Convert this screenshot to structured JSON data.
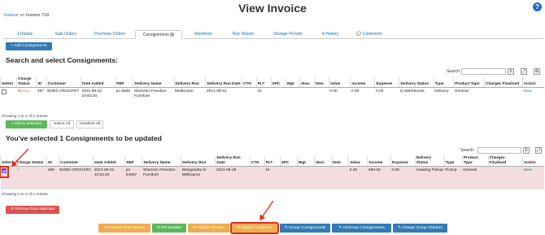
{
  "header": {
    "breadcrumb_link": "Invoice",
    "breadcrumb_rest": " >> Invoice 718",
    "title": "View Invoice",
    "help_glyph": "?"
  },
  "tabs": [
    {
      "label": "Details",
      "icon": "info-icon",
      "glyph": "ℹ"
    },
    {
      "label": "Sale Orders",
      "icon": "",
      "glyph": ""
    },
    {
      "label": "Purchase Orders",
      "icon": "",
      "glyph": ""
    },
    {
      "label": "Consignments",
      "icon": "",
      "glyph": "",
      "badge": "1",
      "active": true
    },
    {
      "label": "Manifests",
      "icon": "",
      "glyph": ""
    },
    {
      "label": "Run Sheets",
      "icon": "",
      "glyph": ""
    },
    {
      "label": "Storage Periods",
      "icon": "",
      "glyph": ""
    },
    {
      "label": "History",
      "icon": "clock-icon",
      "glyph": "⏲"
    },
    {
      "label": "Comments",
      "icon": "comment-icon",
      "glyph": "💬"
    }
  ],
  "add_consignments": "+ Add Consignments",
  "section1": {
    "title": "Search and select Consignments:",
    "search_label": "Search:",
    "clear_glyph": "X",
    "expand_glyph": "⤢",
    "settings_glyph": "⚙",
    "headers": [
      "Select",
      "Charge Status",
      "ID",
      "Customer",
      "Date Added",
      "REF",
      "Delivery Name",
      "Delivery Run",
      "Delivery Run Date",
      "CTN",
      "PLT",
      "SPC",
      "Wgt",
      "desc",
      "Item",
      "Value",
      "Income",
      "Expense",
      "Delivery Status",
      "Type",
      "Product Type",
      "Charges Finalised",
      "Action"
    ],
    "row": {
      "charge_glyph": "✕",
      "charge_note": "(error)",
      "id": "497",
      "customer": "BOBS GROCERY",
      "date": "2021-09-22 10:52:34",
      "ref": "po 5648",
      "delivery_name": "Shenzen Freedom Furniture",
      "delivery_run": "Melbourne",
      "run_date": "2021-09-22",
      "ctn": "",
      "plt": "10",
      "spc": "",
      "wgt": "",
      "desc": "",
      "item": "",
      "value": "0.00",
      "income": "0.00",
      "expense": "0.00",
      "status": "In Warehouse",
      "type": "Delivery",
      "product_type": "General",
      "finalised": "",
      "action": "View"
    },
    "showing": "Showing 1 to 1 of 1 entries",
    "add_to_selection": "+ Add to selection",
    "select_all": "Select All",
    "unselect_all": "Unselect All"
  },
  "section2": {
    "title": "You've selected 1 Consignments to be updated",
    "search_label": "Search:",
    "clear_glyph": "X",
    "expand_glyph": "⤢",
    "headers": [
      "Select",
      "Charge Status",
      "ID",
      "Customer",
      "Date Added",
      "REF",
      "Delivery Name",
      "Delivery Run",
      "Delivery Run Date",
      "CTN",
      "PLT",
      "SPC",
      "Wgt",
      "desc",
      "Item",
      "Value",
      "Income",
      "Expense",
      "Delivery Status",
      "Type",
      "Product Type",
      "Charges Finalised",
      "Action"
    ],
    "row": {
      "charge_glyph": "✓",
      "id": "498",
      "customer": "BOBS GROCERY",
      "date": "2021-09-22 10:53:40",
      "ref": "po 54587",
      "delivery_name": "Shenzen Freedom Furniture",
      "delivery_run": "Wangaratta to Melbourne",
      "run_date": "2021-09-29",
      "ctn": "",
      "plt": "10",
      "spc": "",
      "wgt": "",
      "desc": "",
      "item": "",
      "value": "0.00",
      "income": "650.00",
      "expense": "0.00",
      "status": "Awaiting Pickup",
      "type": "Pickup",
      "product_type": "General",
      "finalised": "",
      "action": "View"
    },
    "showing": "Showing 1 to 1 of 1 entries",
    "remove_from_selection": "✕ Remove from selection"
  },
  "actions": {
    "remove_from_invoice": "✕ Remove from Invoice",
    "recalculate": "⟳ Recalculate",
    "update_charges": "✉ Update charges",
    "update_customer": "✉ Update Customer",
    "group_consignments": "✎ Group Consignments",
    "ungroup_consignments": "✎ UnGroup Consignments",
    "charge_group_children": "✎ Charge Group Children"
  },
  "colors": {
    "primary": "#337ab7",
    "success": "#5cb85c",
    "danger": "#d9534f",
    "warning": "#f0ad4e",
    "annotation": "#e02c1c",
    "selected_row": "#f2dede"
  }
}
